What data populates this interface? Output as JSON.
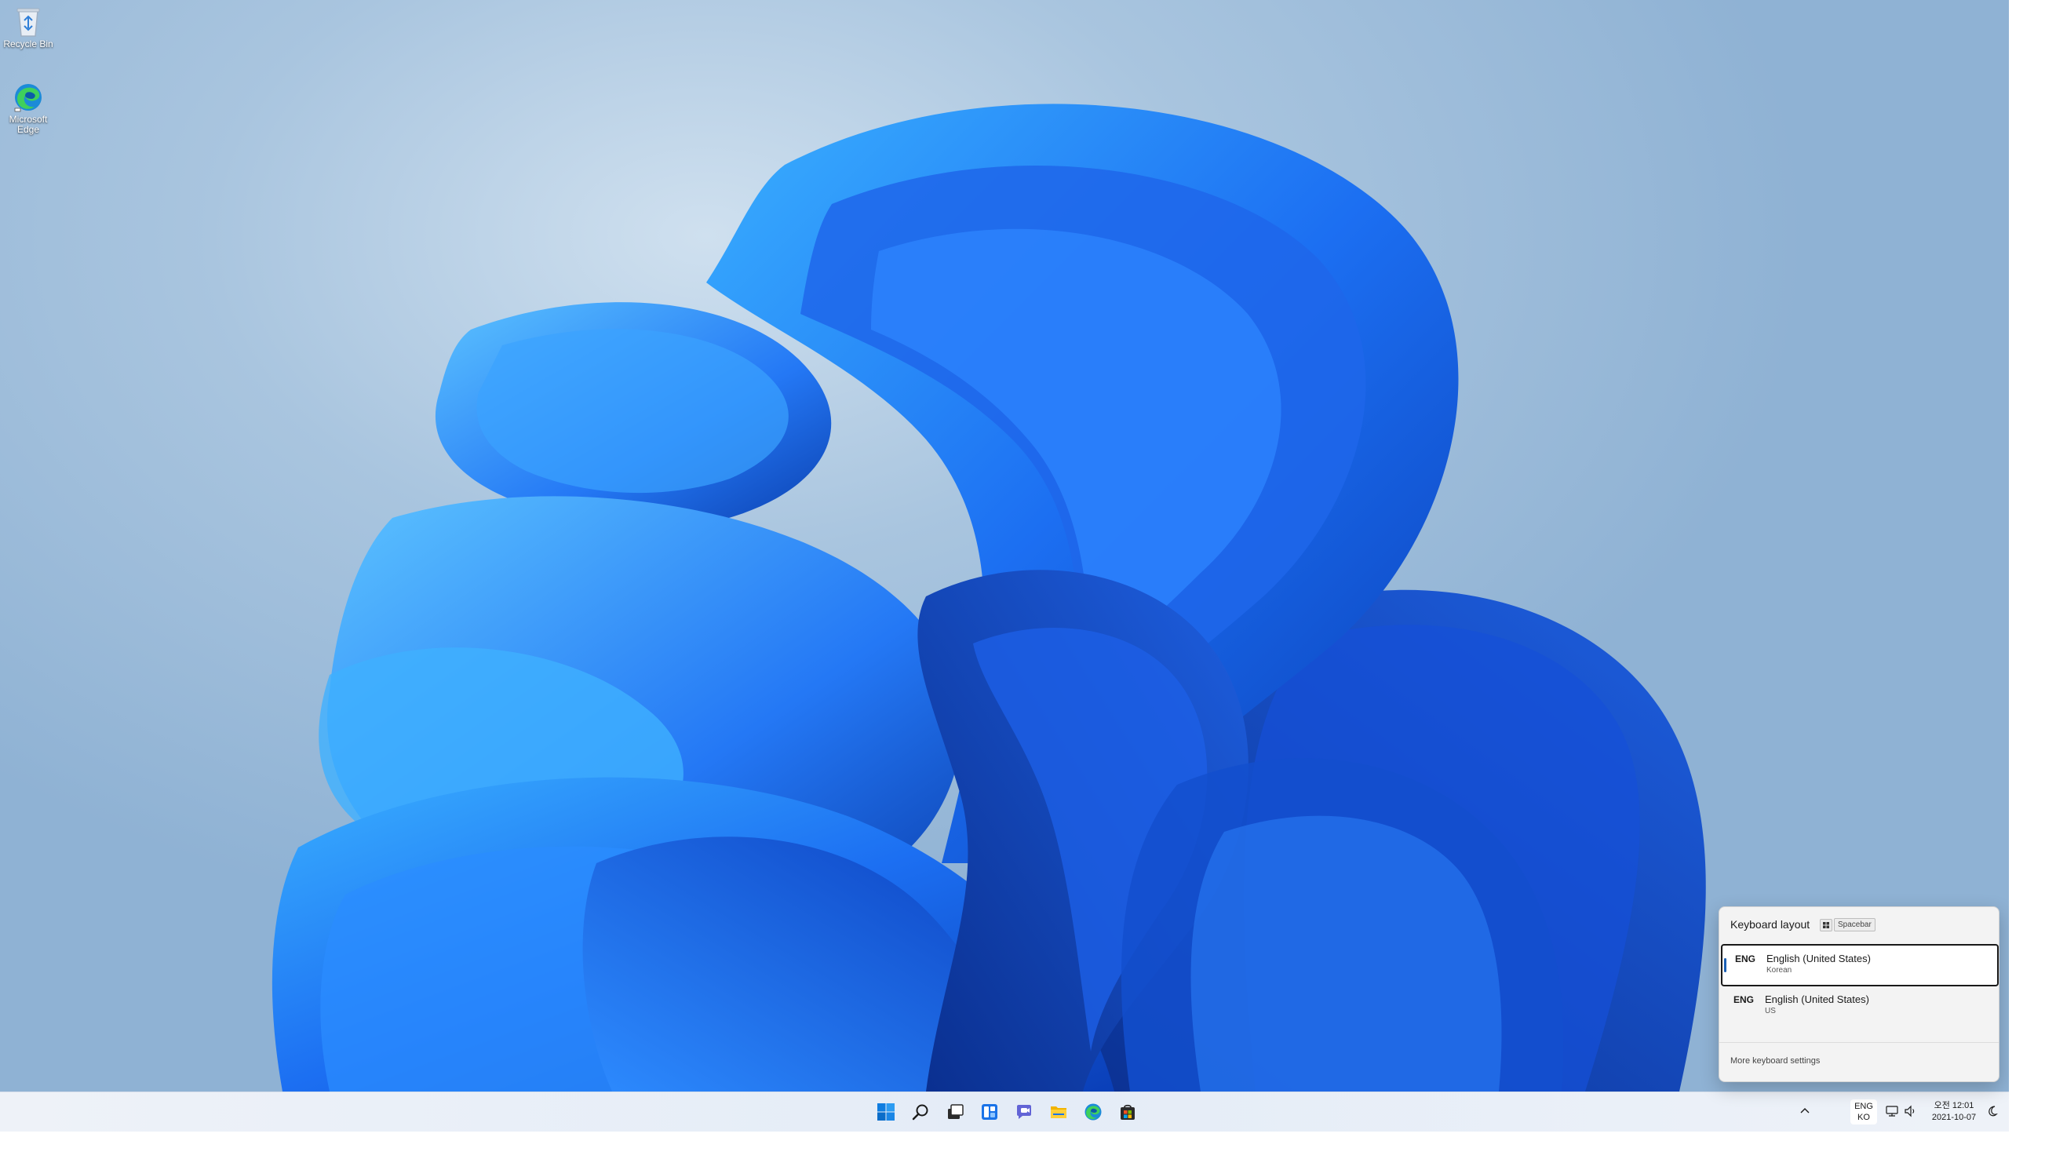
{
  "desktop": {
    "icons": [
      {
        "label": "Recycle Bin",
        "icon": "recycle-bin-icon"
      },
      {
        "label": "Microsoft Edge",
        "icon": "edge-icon"
      }
    ]
  },
  "taskbar": {
    "apps": [
      {
        "name": "Start",
        "icon": "windows-start-icon"
      },
      {
        "name": "Search",
        "icon": "search-icon"
      },
      {
        "name": "Task View",
        "icon": "task-view-icon"
      },
      {
        "name": "Widgets",
        "icon": "widgets-icon"
      },
      {
        "name": "Chat",
        "icon": "teams-chat-icon"
      },
      {
        "name": "File Explorer",
        "icon": "file-explorer-icon"
      },
      {
        "name": "Microsoft Edge",
        "icon": "edge-icon"
      },
      {
        "name": "Microsoft Store",
        "icon": "store-icon"
      }
    ],
    "tray": {
      "language_line1": "ENG",
      "language_line2": "KO",
      "time": "오전 12:01",
      "date": "2021-10-07"
    }
  },
  "keyboard_flyout": {
    "title": "Keyboard layout",
    "shortcut_key": "Spacebar",
    "items": [
      {
        "code": "ENG",
        "name": "English (United States)",
        "sub": "Korean",
        "selected": true
      },
      {
        "code": "ENG",
        "name": "English (United States)",
        "sub": "US",
        "selected": false
      }
    ],
    "more_link": "More keyboard settings"
  },
  "colors": {
    "accent": "#0078d4",
    "wallpaper_blue": "#1a6ff0",
    "taskbar_bg": "#eef2f8"
  }
}
